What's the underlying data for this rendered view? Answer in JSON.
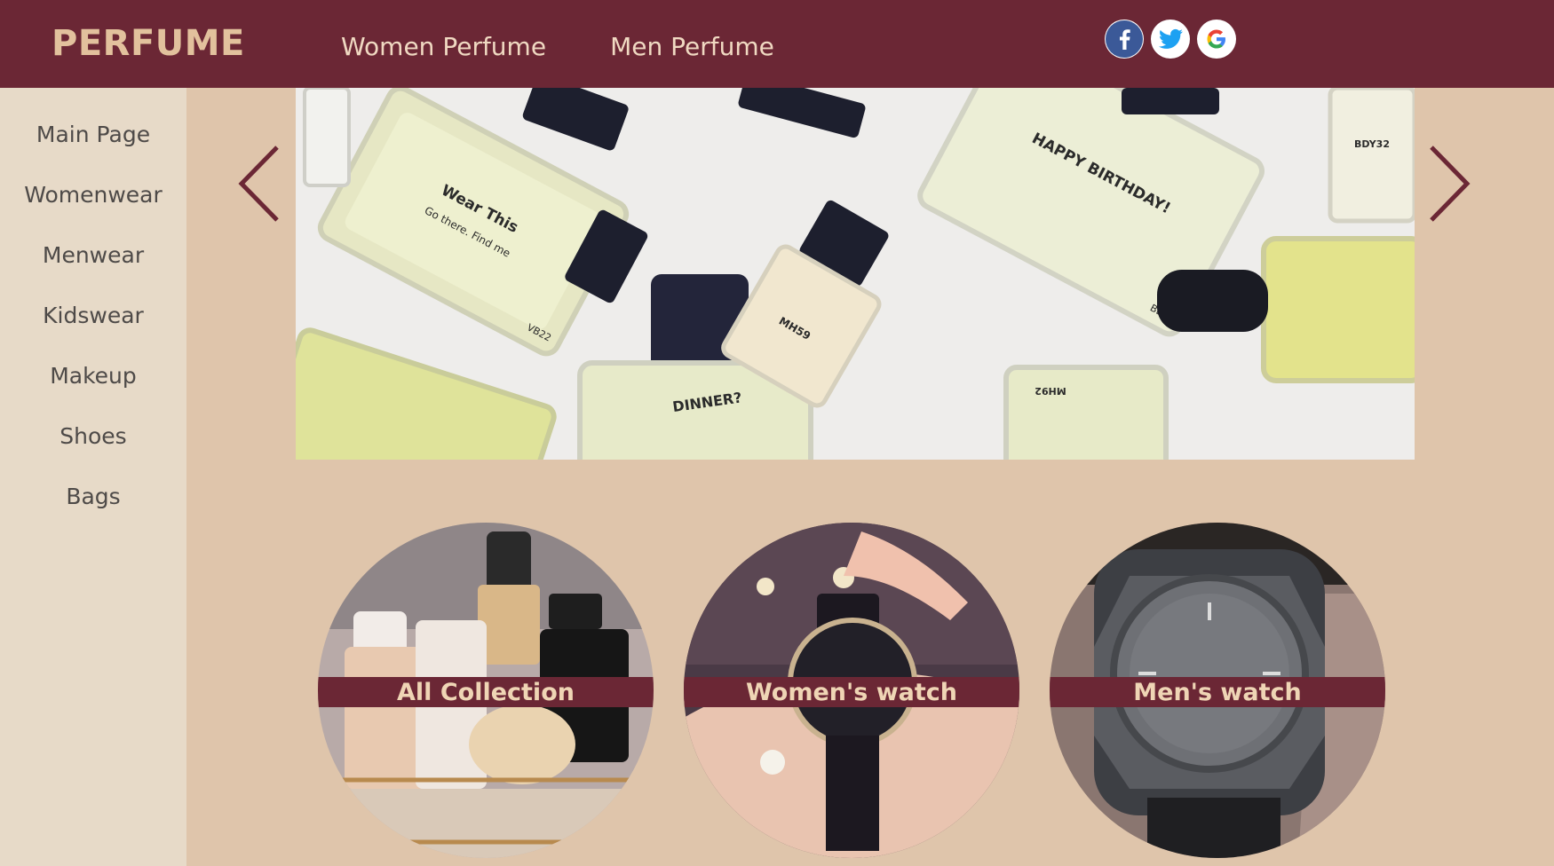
{
  "brand": "PERFUME",
  "topnav": [
    "Women Perfume",
    "Men Perfume"
  ],
  "social": [
    {
      "icon": "facebook-icon",
      "color": "#3b5998"
    },
    {
      "icon": "twitter-icon",
      "color": "#1da1f2"
    },
    {
      "icon": "google-icon",
      "color": "#4285f4"
    }
  ],
  "sidebar": {
    "items": [
      "Main Page",
      "Womenwear",
      "Menwear",
      "Kidswear",
      "Makeup",
      "Shoes",
      "Bags"
    ]
  },
  "slider": {
    "bottle_labels": [
      "Wear This",
      "Go there. Find me",
      "HAPPY BIRTHDAY!",
      "MH59",
      "DINNER?",
      "BDY89",
      "BDY32",
      "VB22",
      "MH92"
    ]
  },
  "categories": [
    {
      "label": "All Collection"
    },
    {
      "label": "Women's watch"
    },
    {
      "label": "Men's watch"
    }
  ],
  "colors": {
    "header": "#6b2735",
    "brand_text": "#e2c19d",
    "sidebar_bg": "#e7dac8",
    "page_bg": "#dfc5ab",
    "arrow": "#6b2735"
  }
}
